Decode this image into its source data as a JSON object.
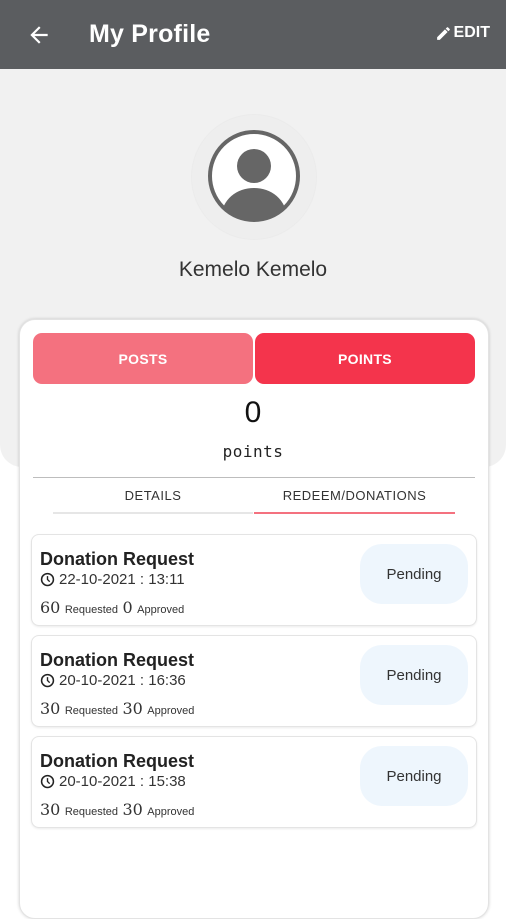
{
  "app_bar": {
    "title": "My Profile",
    "edit_label": "EDIT",
    "back_icon": "arrow-left-icon",
    "edit_icon": "pencil-icon",
    "color": "#5b5d60"
  },
  "profile": {
    "name": "Kemelo Kemelo",
    "avatar_icon": "user-avatar-icon"
  },
  "segments": {
    "posts_label": "POSTS",
    "points_label": "POINTS",
    "selected": "POINTS",
    "posts_color": "#f4717f",
    "points_color": "#f4344c"
  },
  "points": {
    "value": "0",
    "label": "points"
  },
  "tabs": {
    "details_label": "DETAILS",
    "redeem_label": "REDEEM/DONATIONS",
    "selected": "REDEEM/DONATIONS"
  },
  "requests": [
    {
      "title": "Donation Request",
      "datetime": "22-10-2021 : 13:11",
      "requested": "60",
      "requested_label": "Requested",
      "approved": "0",
      "approved_label": "Approved",
      "status": "Pending"
    },
    {
      "title": "Donation Request",
      "datetime": "20-10-2021 : 16:36",
      "requested": "30",
      "requested_label": "Requested",
      "approved": "30",
      "approved_label": "Approved",
      "status": "Pending"
    },
    {
      "title": "Donation Request",
      "datetime": "20-10-2021 : 15:38",
      "requested": "30",
      "requested_label": "Requested",
      "approved": "30",
      "approved_label": "Approved",
      "status": "Pending"
    }
  ]
}
